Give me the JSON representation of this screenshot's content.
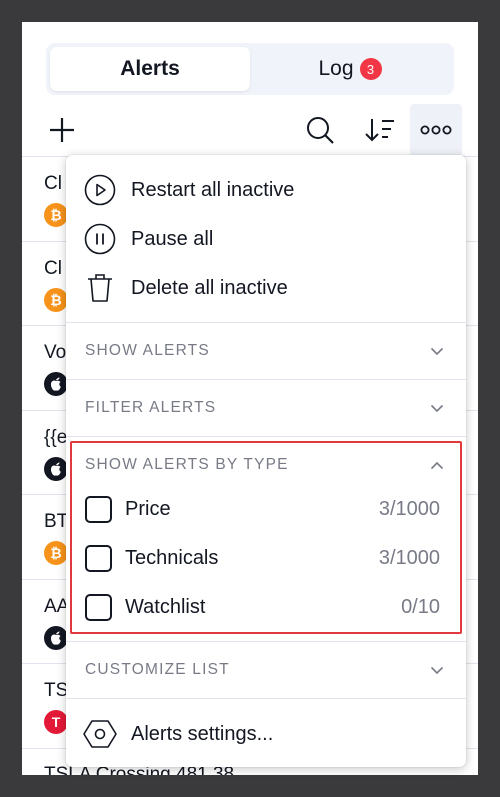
{
  "tabs": [
    {
      "label": "Alerts",
      "active": true
    },
    {
      "label": "Log",
      "badge": "3"
    }
  ],
  "toolbar": {
    "add_icon": "plus-icon",
    "search_icon": "search-icon",
    "sort_icon": "sort-icon",
    "more_icon": "more-horizontal-icon"
  },
  "alerts_list": [
    {
      "title": "Cl",
      "symbol": "₿",
      "color": "#f7931a"
    },
    {
      "title": "Cl",
      "symbol": "₿",
      "color": "#f7931a"
    },
    {
      "title": "Vo",
      "symbol": "",
      "color": "#131722"
    },
    {
      "title": "{{e",
      "symbol": "",
      "color": "#131722"
    },
    {
      "title": "BT",
      "symbol": "₿",
      "color": "#f7931a"
    },
    {
      "title": "AA",
      "symbol": "",
      "color": "#131722"
    },
    {
      "title": "TS",
      "symbol": "T",
      "color": "#e31937"
    },
    {
      "title": "TSLA Crossing 481.38"
    }
  ],
  "menu": {
    "actions": [
      {
        "label": "Restart all inactive",
        "icon": "play-circle-icon"
      },
      {
        "label": "Pause all",
        "icon": "pause-circle-icon"
      },
      {
        "label": "Delete all inactive",
        "icon": "trash-icon"
      }
    ],
    "sections": {
      "show_alerts": "SHOW ALERTS",
      "filter_alerts": "FILTER ALERTS",
      "show_by_type": "SHOW ALERTS BY TYPE",
      "customize": "CUSTOMIZE LIST"
    },
    "types": [
      {
        "label": "Price",
        "count": "3/1000",
        "checked": false
      },
      {
        "label": "Technicals",
        "count": "3/1000",
        "checked": false
      },
      {
        "label": "Watchlist",
        "count": "0/10",
        "checked": false
      }
    ],
    "settings": {
      "label": "Alerts settings...",
      "icon": "settings-hexagon-icon"
    }
  },
  "colors": {
    "accent_red": "#e03a3e",
    "badge_red": "#f23645",
    "muted": "#787b86"
  }
}
